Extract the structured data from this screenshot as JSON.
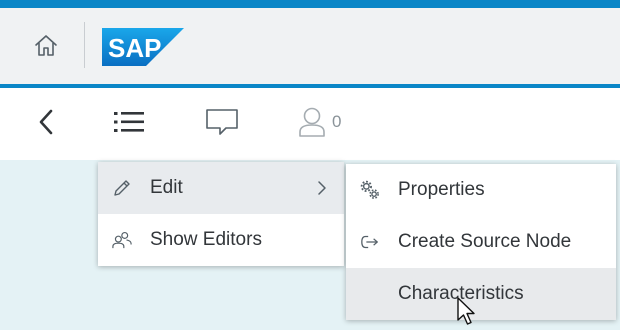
{
  "shell": {
    "logo_text": "SAP",
    "accent_color": "#0a86c7",
    "home_icon": "home-icon"
  },
  "toolbar": {
    "back_icon": "chevron-left-icon",
    "list_icon": "list-icon",
    "comment_icon": "comment-icon",
    "user_icon": "person-icon",
    "user_count": "0"
  },
  "menu_primary": {
    "items": [
      {
        "label": "Edit",
        "icon": "pencil-icon",
        "has_submenu": true,
        "highlighted": true
      },
      {
        "label": "Show Editors",
        "icon": "group-icon",
        "has_submenu": false,
        "highlighted": false
      }
    ]
  },
  "menu_submenu": {
    "items": [
      {
        "label": "Properties",
        "icon": "gears-icon",
        "highlighted": false
      },
      {
        "label": "Create Source Node",
        "icon": "create-arrow-icon",
        "highlighted": false
      },
      {
        "label": "Characteristics",
        "icon": "",
        "highlighted": true
      }
    ]
  }
}
